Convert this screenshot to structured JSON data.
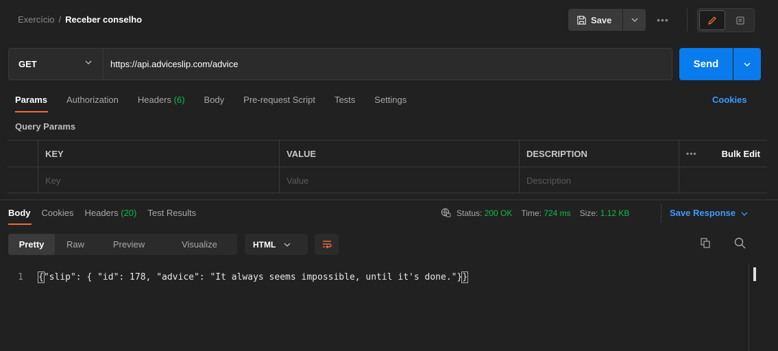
{
  "breadcrumb": {
    "parent": "Exercício",
    "separator": "/",
    "current": "Receber conselho"
  },
  "toolbar": {
    "save_label": "Save",
    "more_label": "•••"
  },
  "request": {
    "method": "GET",
    "url": "https://api.adviceslip.com/advice",
    "send_label": "Send"
  },
  "request_tabs": {
    "params": "Params",
    "authorization": "Authorization",
    "headers_label": "Headers",
    "headers_count": "(6)",
    "body": "Body",
    "prerequest": "Pre-request Script",
    "tests": "Tests",
    "settings": "Settings",
    "cookies": "Cookies"
  },
  "query_params": {
    "label": "Query Params",
    "columns": {
      "key": "KEY",
      "value": "VALUE",
      "description": "DESCRIPTION",
      "more": "•••",
      "bulk_edit": "Bulk Edit"
    },
    "placeholders": {
      "key": "Key",
      "value": "Value",
      "description": "Description"
    }
  },
  "response_tabs": {
    "body": "Body",
    "cookies": "Cookies",
    "headers_label": "Headers",
    "headers_count": "(20)",
    "test_results": "Test Results"
  },
  "response_status": {
    "status_label": "Status:",
    "status_value": "200 OK",
    "time_label": "Time:",
    "time_value": "724 ms",
    "size_label": "Size:",
    "size_value": "1.12 KB",
    "save_response": "Save Response"
  },
  "view_tabs": [
    "Pretty",
    "Raw",
    "Preview",
    "Visualize"
  ],
  "format": "HTML",
  "code": {
    "line_number": "1",
    "open_brace": "{",
    "content": "\"slip\": { \"id\": 178, \"advice\": \"It always seems impossible, until it's done.\"}",
    "close_brace": "}"
  },
  "colors": {
    "accent": "#097bed",
    "tab_underline": "#f26b3a",
    "success": "#0cbb52",
    "link": "#3b9cff"
  }
}
